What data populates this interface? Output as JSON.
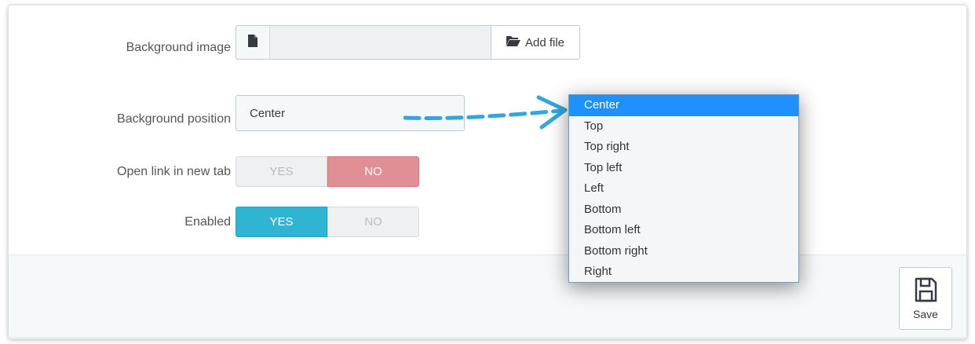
{
  "form": {
    "background_image": {
      "label": "Background image",
      "add_file_label": "Add file",
      "file_value": ""
    },
    "background_position": {
      "label": "Background position",
      "selected": "Center",
      "options": [
        "Center",
        "Top",
        "Top right",
        "Top left",
        "Left",
        "Bottom",
        "Bottom left",
        "Bottom right",
        "Right"
      ]
    },
    "open_link_new_tab": {
      "label": "Open link in new tab",
      "yes_label": "YES",
      "no_label": "NO",
      "value": "NO"
    },
    "enabled": {
      "label": "Enabled",
      "yes_label": "YES",
      "no_label": "NO",
      "value": "YES"
    }
  },
  "footer": {
    "save_label": "Save"
  },
  "colors": {
    "accent_blue": "#2fb5d2",
    "no_red": "#e08f95",
    "dropdown_highlight": "#1e90ff",
    "annotation_arrow": "#33a7dd"
  },
  "icons": {
    "file": "file-icon",
    "folder": "folder-open-icon",
    "save": "floppy-disk-icon",
    "annotation": "dashed-arrow-icon"
  }
}
